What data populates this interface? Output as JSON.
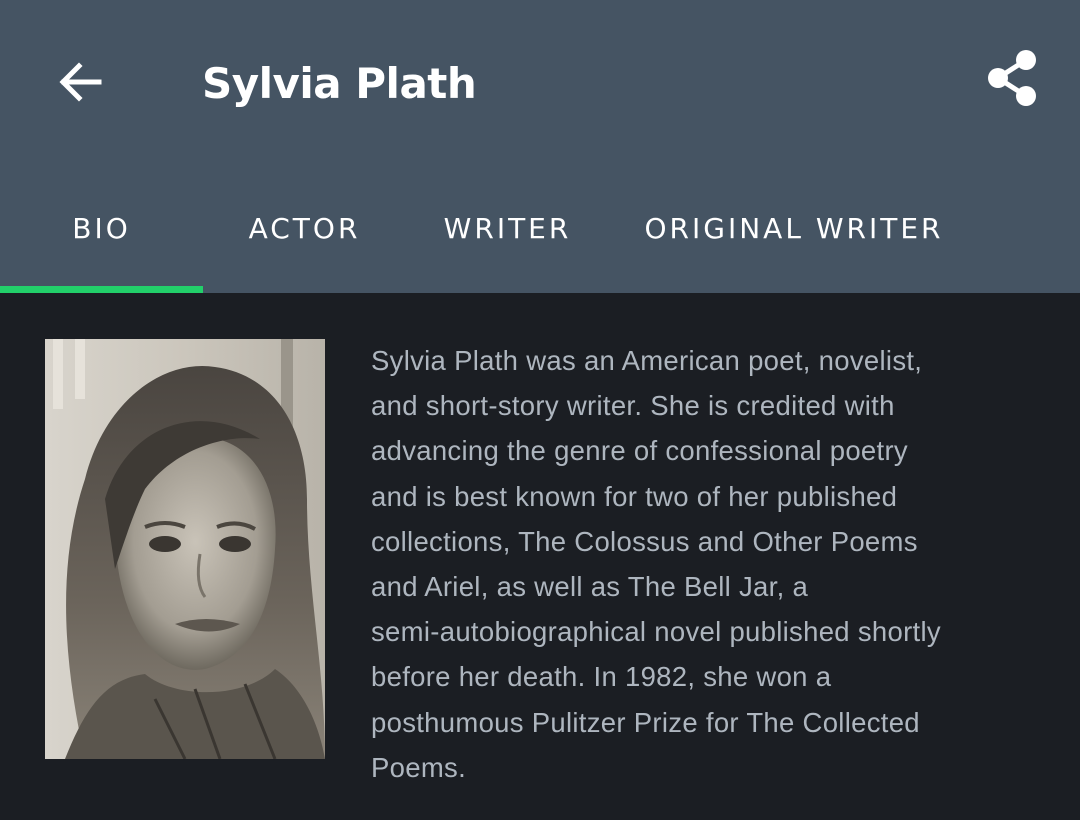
{
  "header": {
    "title": "Sylvia Plath",
    "back_icon": "arrow-left-icon",
    "share_icon": "share-icon"
  },
  "tabs": [
    {
      "label": "BIO",
      "selected": true
    },
    {
      "label": "ACTOR",
      "selected": false
    },
    {
      "label": "WRITER",
      "selected": false
    },
    {
      "label": "ORIGINAL WRITER",
      "selected": false
    }
  ],
  "bio": {
    "text": "Sylvia Plath was an American poet, novelist,\nand short-story writer. She is credited with\nadvancing the genre of confessional poetry\nand is best known for two of her published\ncollections, The Colossus and Other Poems\nand Ariel, as well as The Bell Jar, a\nsemi-autobiographical novel published shortly\nbefore her death. In 1982, she won a\nposthumous Pulitzer Prize for The Collected\nPoems."
  },
  "colors": {
    "header_bg": "#455463",
    "content_bg": "#1b1e23",
    "accent": "#22d06a",
    "bio_text": "#aeb6bf"
  }
}
